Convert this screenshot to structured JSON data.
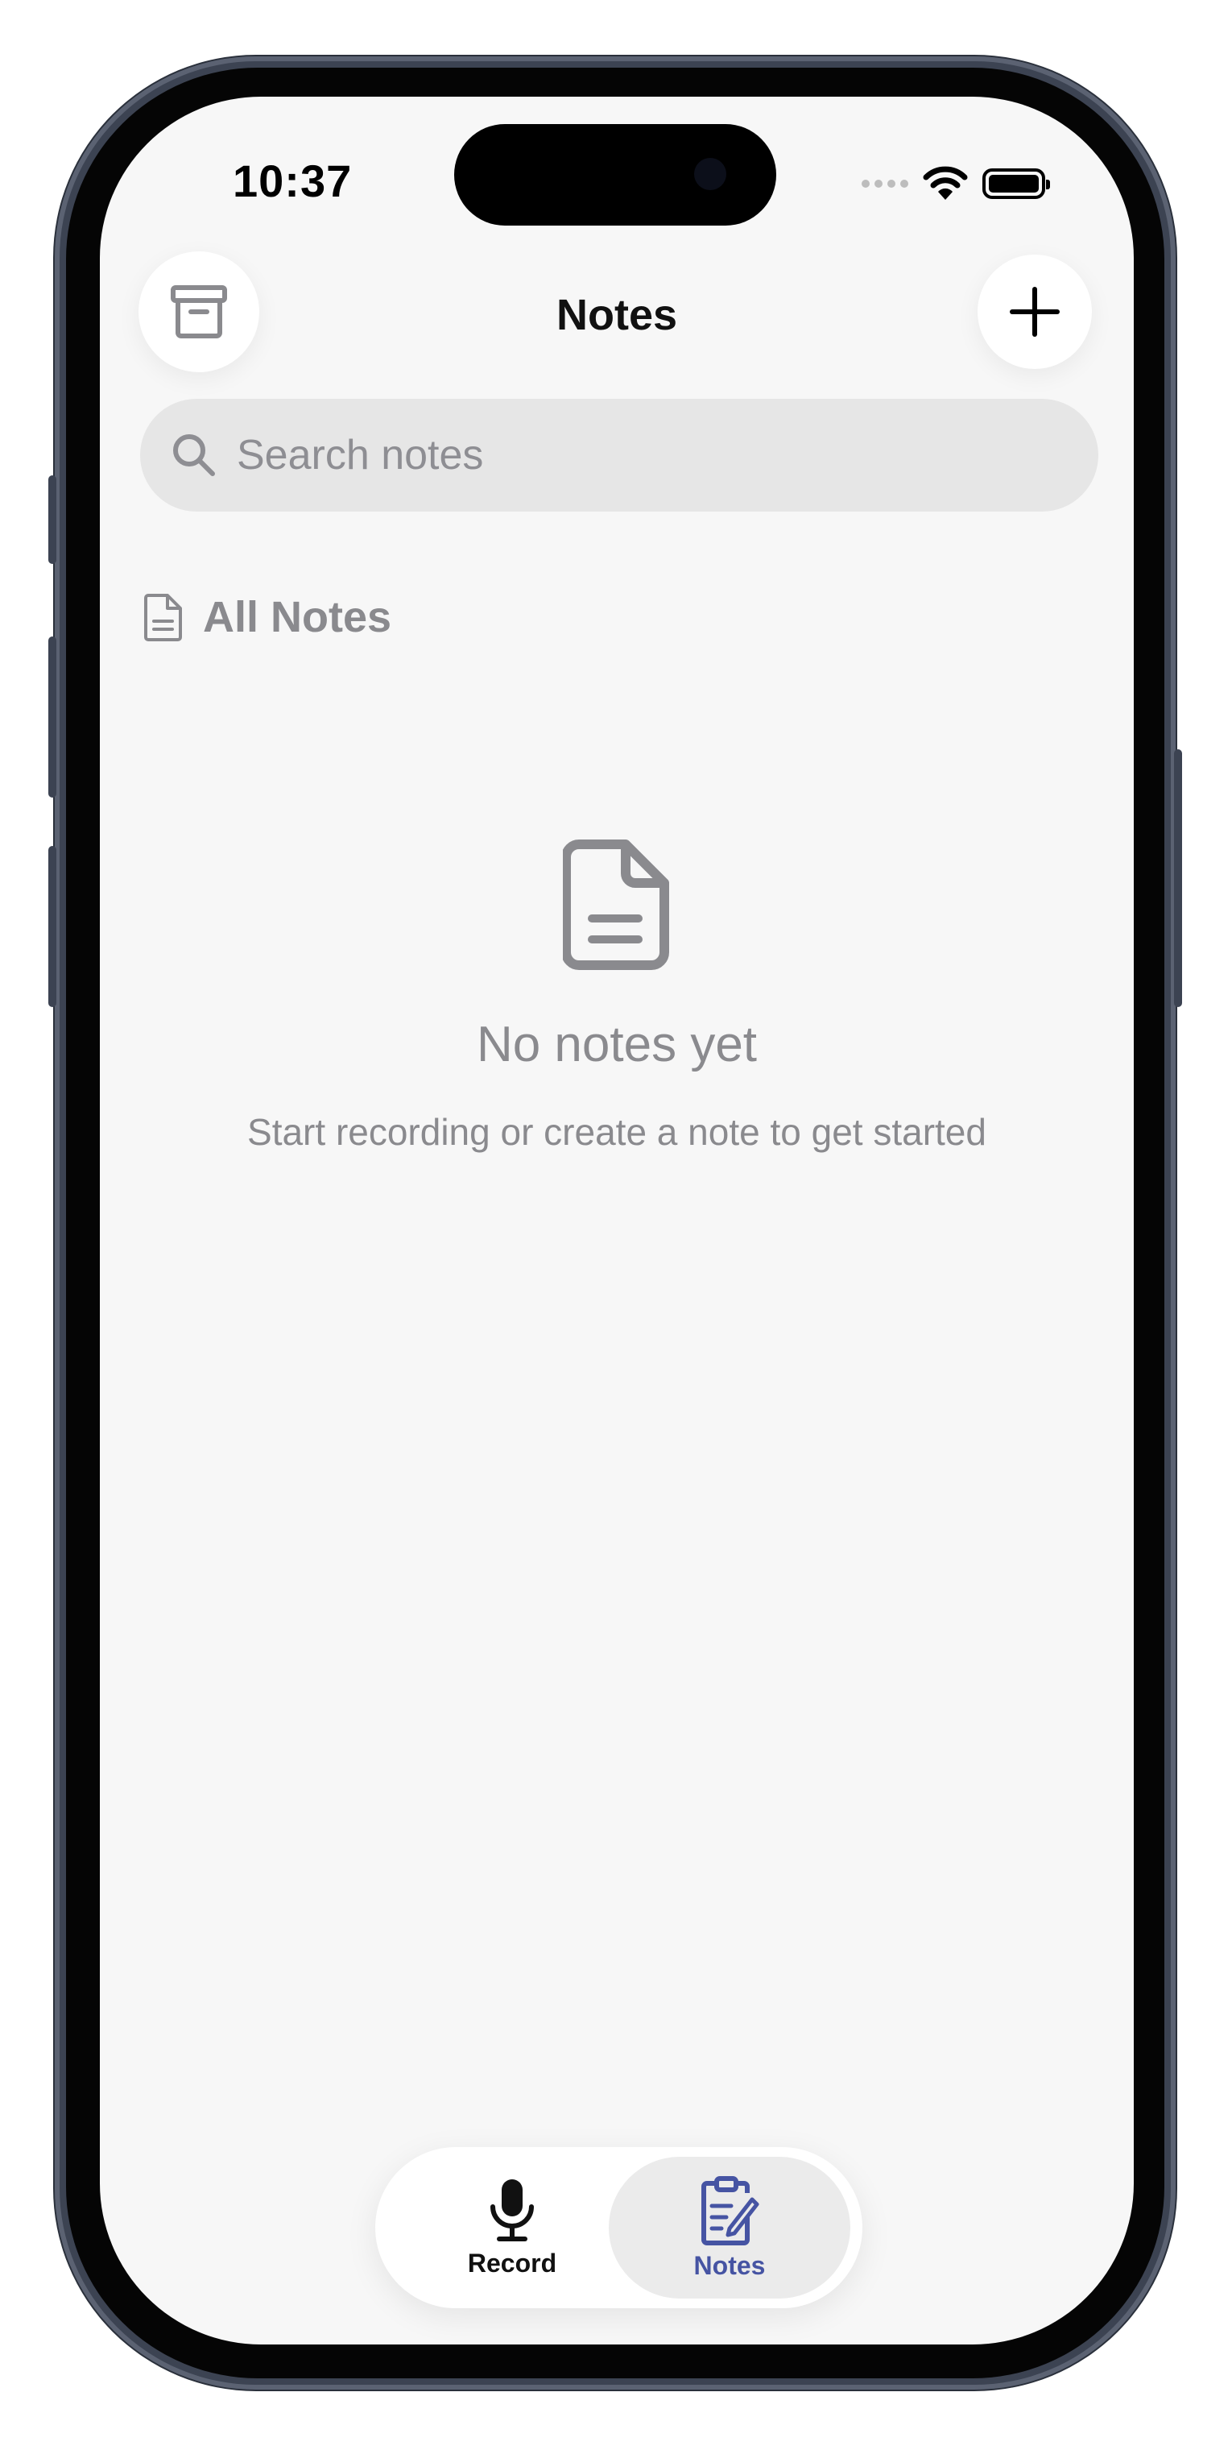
{
  "status_bar": {
    "time": "10:37"
  },
  "header": {
    "title": "Notes",
    "archive_icon": "archive-box-icon",
    "add_icon": "plus-icon"
  },
  "search": {
    "placeholder": "Search notes",
    "value": ""
  },
  "section": {
    "label": "All Notes"
  },
  "empty_state": {
    "title": "No notes yet",
    "subtitle": "Start recording or create a note to get started"
  },
  "tab_bar": {
    "tabs": [
      {
        "label": "Record",
        "icon": "microphone-icon",
        "selected": false
      },
      {
        "label": "Notes",
        "icon": "clipboard-edit-icon",
        "selected": true
      }
    ]
  },
  "colors": {
    "accent": "#4654a3",
    "background": "#f7f7f7",
    "muted_text": "#8a8a8e"
  }
}
